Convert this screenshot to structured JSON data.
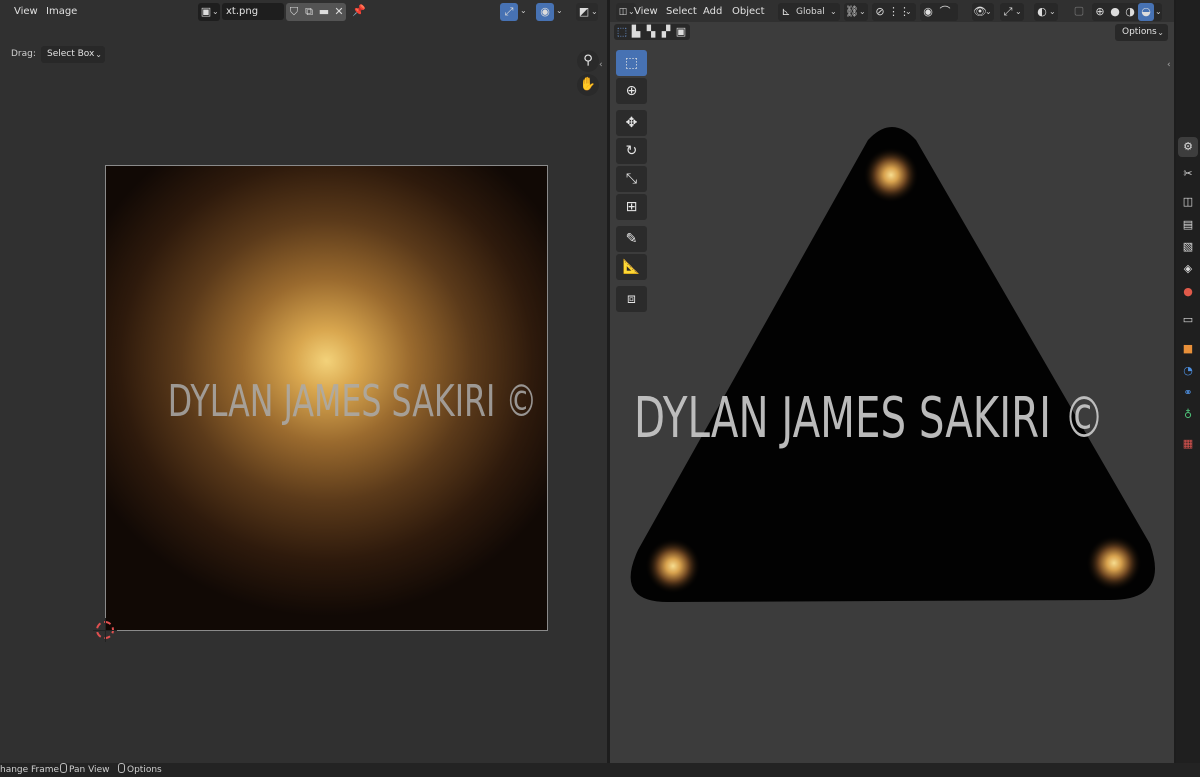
{
  "image_editor": {
    "menu": [
      "View",
      "Image"
    ],
    "filename": "xt.png",
    "drag_label": "Drag:",
    "drag_mode": "Select Box",
    "watermark": "DYLAN JAMES SAKIRI ©"
  },
  "viewport": {
    "menu": [
      "View",
      "Select",
      "Add",
      "Object"
    ],
    "transform_orientation": "Global",
    "options_label": "Options",
    "watermark": "DYLAN JAMES SAKIRI ©",
    "tools": [
      "select-box",
      "cursor",
      "move",
      "rotate",
      "scale",
      "transform",
      "annotate",
      "measure",
      "add-cube"
    ]
  },
  "status_bar": {
    "items": [
      "hange Frame",
      "Pan View",
      "Options"
    ]
  },
  "colors": {
    "accent_blue": "#4772b3",
    "editor_bg": "#303030",
    "viewport_bg": "#3c3c3c",
    "glow_center": "#f3d27a"
  }
}
